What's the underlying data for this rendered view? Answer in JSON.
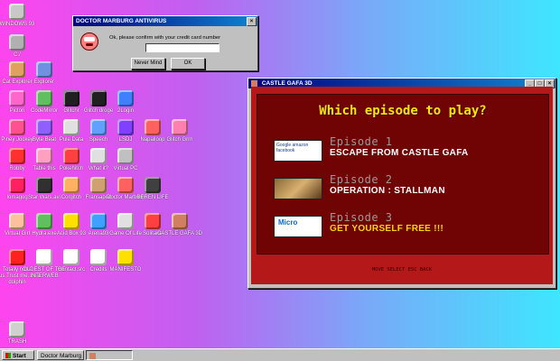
{
  "desktop": {
    "icons": [
      {
        "label": "WINDOWS 93",
        "color": "#c8c8c8",
        "icon": "computer-icon"
      },
      {
        "label": "C:/",
        "color": "#b0b0b0",
        "icon": "drive-icon"
      },
      {
        "label": "Cat Explorer",
        "color": "#e0a060",
        "icon": "cat-icon"
      },
      {
        "label": "Explorer",
        "color": "#7090e0",
        "icon": "explorer-icon"
      },
      {
        "label": "Pictori",
        "color": "#ff66cc",
        "icon": "paint-icon"
      },
      {
        "label": "CodeMirror",
        "color": "#60c060",
        "icon": "code-icon"
      },
      {
        "label": "Glitchr",
        "color": "#202020",
        "icon": "glitch-icon"
      },
      {
        "label": "Glitch droge",
        "color": "#202020",
        "icon": "glitch-icon"
      },
      {
        "label": "2Login",
        "color": "#4080ff",
        "icon": "login-icon"
      },
      {
        "label": "Piney Jockey",
        "color": "#ff5090",
        "icon": "jockey-icon"
      },
      {
        "label": "Byte Beat",
        "color": "#9060ff",
        "icon": "music-icon"
      },
      {
        "label": "Pule Data",
        "color": "#e0e0e0",
        "icon": "data-icon"
      },
      {
        "label": "Speech",
        "color": "#60a0ff",
        "icon": "speech-icon"
      },
      {
        "label": "LSDJ",
        "color": "#8040ff",
        "icon": "lsdj-icon"
      },
      {
        "label": "Napalloop",
        "color": "#ff6060",
        "icon": "loop-icon"
      },
      {
        "label": "Glitch Grrrl",
        "color": "#ff80b0",
        "icon": "heart-icon"
      },
      {
        "label": "Robby",
        "color": "#ff3030",
        "icon": "robot-icon"
      },
      {
        "label": "Table this",
        "color": "#ffa0c0",
        "icon": "table-icon"
      },
      {
        "label": "Pokehitch",
        "color": "#ff4040",
        "icon": "pokeball-icon"
      },
      {
        "label": "What it?",
        "color": "#e0e0e0",
        "icon": "question-icon"
      },
      {
        "label": "Virtual PC",
        "color": "#c0c0c0",
        "icon": "pc-icon"
      },
      {
        "label": "Iomagog",
        "color": "#ff2060",
        "icon": "flower-icon"
      },
      {
        "label": "Star Wars.avi",
        "color": "#303030",
        "icon": "video-icon"
      },
      {
        "label": "Corgitch",
        "color": "#ffb060",
        "icon": "dog-icon"
      },
      {
        "label": "Fransapod",
        "color": "#d0a070",
        "icon": "scanner-icon"
      },
      {
        "label": "Doctor Marburg",
        "color": "#ff6060",
        "icon": "doctor-icon"
      },
      {
        "label": "BEREN LIFE",
        "color": "#404040",
        "icon": "terminal-icon"
      },
      {
        "label": "Virtual Girl",
        "color": "#ffc0a0",
        "icon": "girl-icon"
      },
      {
        "label": "Hydra.exe",
        "color": "#60c060",
        "icon": "hydra-icon"
      },
      {
        "label": "Acid Box 93",
        "color": "#ffe000",
        "icon": "smiley-icon"
      },
      {
        "label": "Arena93",
        "color": "#40a0ff",
        "icon": "cube-icon"
      },
      {
        "label": "Game Of Life",
        "color": "#e0e0e0",
        "icon": "grid-icon"
      },
      {
        "label": "Solitaire",
        "color": "#ff4040",
        "icon": "cards-icon"
      },
      {
        "label": "CASTLE GAFA 3D",
        "color": "#d08060",
        "icon": "castle-icon"
      },
      {
        "label": "Totally not a virus.Trust me..im a dolphin",
        "color": "#ff2020",
        "icon": "virus-icon"
      },
      {
        "label": "OLDEST OF THE INTERWEB",
        "color": "#ffffff",
        "icon": "document-icon"
      },
      {
        "label": "Contact.src",
        "color": "#ffffff",
        "icon": "contact-icon"
      },
      {
        "label": "Credits",
        "color": "#ffffff",
        "icon": "credits-icon"
      },
      {
        "label": "MANIFESTO",
        "color": "#ffe000",
        "icon": "manifesto-icon"
      },
      {
        "label": "TRASH",
        "color": "#d0d0d0",
        "icon": "trash-icon"
      }
    ]
  },
  "antivirus": {
    "title": "DOCTOR MARBURG ANTIVIRUS",
    "message": "Ok, please confirm with your credit card number",
    "input_value": "",
    "btn_never": "Never Mind",
    "btn_ok": "OK"
  },
  "game": {
    "title": "CASTLE GAFA 3D",
    "heading": "Which episode to play?",
    "episodes": [
      {
        "title": "Episode 1",
        "subtitle": "ESCAPE FROM CASTLE GAFA",
        "thumb": "Google amazon facebook"
      },
      {
        "title": "Episode 2",
        "subtitle": "OPERATION : STALLMAN",
        "thumb": ""
      },
      {
        "title": "Episode 3",
        "subtitle": "GET YOURSELF FREE !!!",
        "thumb": "Micro"
      }
    ],
    "footer": "MOVE  SELECT  ESC BACK"
  },
  "taskbar": {
    "start": "Start",
    "tasks": [
      "Doctor Marburg A",
      ""
    ]
  },
  "colors": {
    "desktop_left": "#ff44ee",
    "desktop_right": "#3ee6ff",
    "game_frame": "#b41818",
    "game_heading": "#ffe600"
  }
}
